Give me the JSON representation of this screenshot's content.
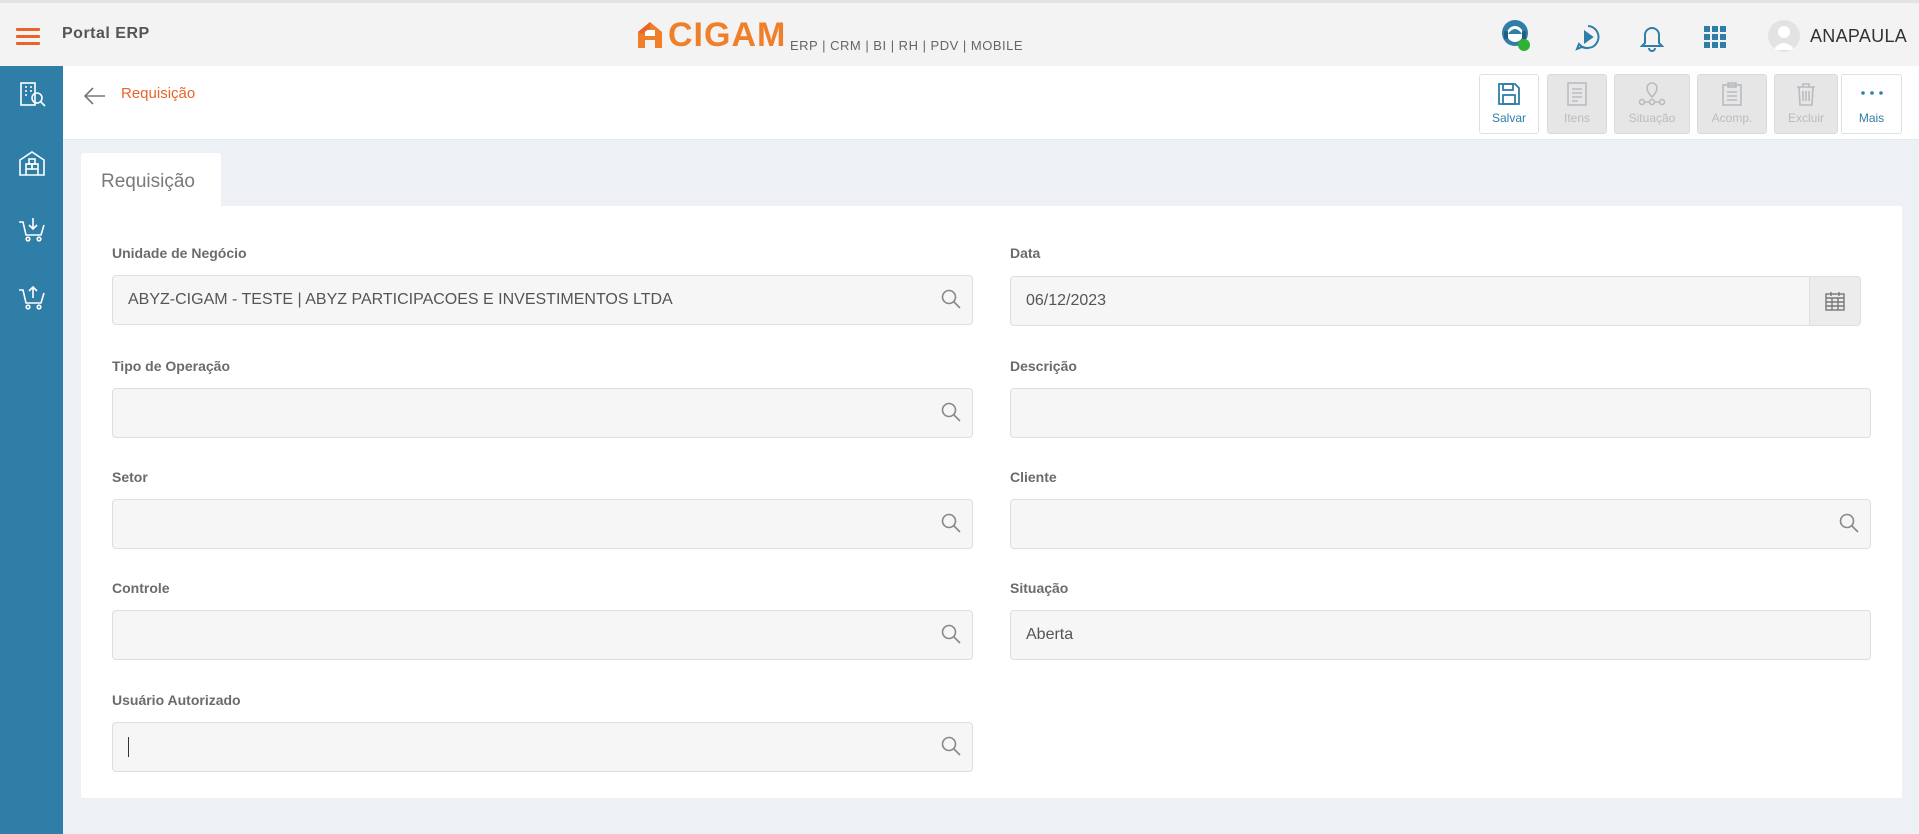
{
  "header": {
    "portal_title": "Portal ERP",
    "logo_text": "CIGAM",
    "logo_subtitle": "ERP | CRM | BI | RH | PDV | MOBILE",
    "user_name": "ANAPAULA",
    "icons": [
      "hamburger-icon",
      "support-agent-icon",
      "chat-play-icon",
      "bell-icon",
      "apps-grid-icon",
      "user-avatar-icon"
    ],
    "accent_color": "#e8642b",
    "online_status_color": "#2eb135"
  },
  "sidebar": {
    "background": "#2f7ea7",
    "items": [
      {
        "icon": "building-search-icon"
      },
      {
        "icon": "warehouse-icon"
      },
      {
        "icon": "cart-download-icon"
      },
      {
        "icon": "cart-upload-icon"
      }
    ]
  },
  "page": {
    "breadcrumb": "Requisição",
    "tab_label": "Requisição"
  },
  "toolbar": {
    "buttons": [
      {
        "label": "Salvar",
        "icon": "save-icon",
        "enabled": true
      },
      {
        "label": "Itens",
        "icon": "list-doc-icon",
        "enabled": false
      },
      {
        "label": "Situação",
        "icon": "workflow-icon",
        "enabled": false
      },
      {
        "label": "Acomp.",
        "icon": "clipboard-icon",
        "enabled": false
      },
      {
        "label": "Excluir",
        "icon": "trash-icon",
        "enabled": false
      },
      {
        "label": "Mais",
        "icon": "more-dots-icon",
        "enabled": true
      }
    ]
  },
  "form": {
    "unidade": {
      "label": "Unidade de Negócio",
      "value": "ABYZ-CIGAM - TESTE | ABYZ PARTICIPACOES E INVESTIMENTOS LTDA"
    },
    "data": {
      "label": "Data",
      "value": "06/12/2023"
    },
    "tipo_operacao": {
      "label": "Tipo de Operação",
      "value": ""
    },
    "descricao": {
      "label": "Descrição",
      "value": ""
    },
    "setor": {
      "label": "Setor",
      "value": ""
    },
    "cliente": {
      "label": "Cliente",
      "value": ""
    },
    "controle": {
      "label": "Controle",
      "value": ""
    },
    "situacao": {
      "label": "Situação",
      "value": "Aberta"
    },
    "usuario_autorizado": {
      "label": "Usuário Autorizado",
      "value": ""
    }
  }
}
